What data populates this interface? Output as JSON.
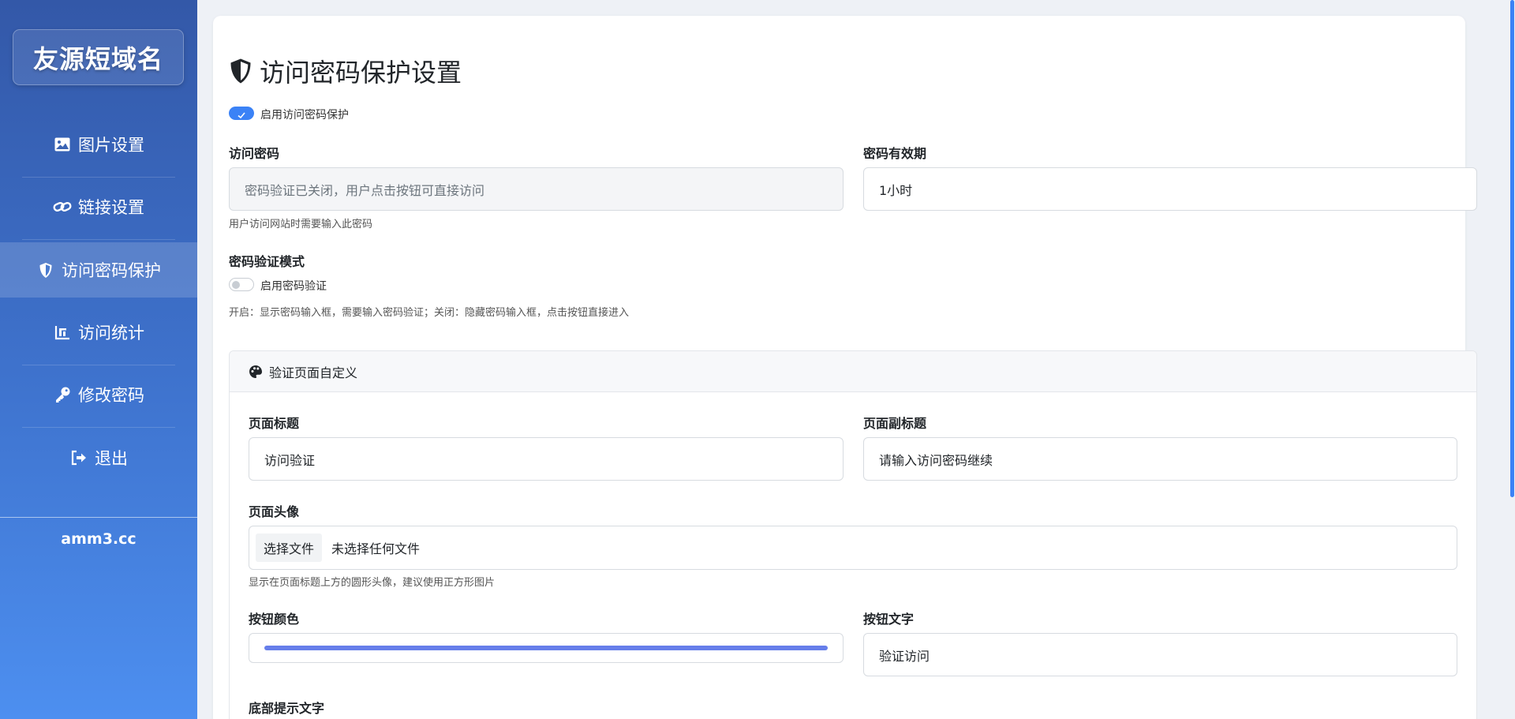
{
  "sidebar": {
    "brand": "友源短域名",
    "items": [
      {
        "label": "图片设置",
        "icon": "image-icon"
      },
      {
        "label": "链接设置",
        "icon": "link-icon"
      },
      {
        "label": "访问密码保护",
        "icon": "shield-icon",
        "active": true
      },
      {
        "label": "访问统计",
        "icon": "chart-icon"
      },
      {
        "label": "修改密码",
        "icon": "key-icon"
      },
      {
        "label": "退出",
        "icon": "logout-icon"
      }
    ],
    "domain": "amm3.cc"
  },
  "page": {
    "title": "访问密码保护设置",
    "enable_protection_label": "启用访问密码保护",
    "enable_protection_on": true,
    "password_label": "访问密码",
    "password_placeholder": "密码验证已关闭，用户点击按钮可直接访问",
    "password_help": "用户访问网站时需要输入此密码",
    "expiry_label": "密码有效期",
    "expiry_value": "1小时",
    "verify_mode_label": "密码验证模式",
    "verify_switch_label": "启用密码验证",
    "verify_switch_on": false,
    "verify_help": "开启：显示密码输入框，需要输入密码验证；关闭：隐藏密码输入框，点击按钮直接进入"
  },
  "custom_panel": {
    "header": "验证页面自定义",
    "page_title_label": "页面标题",
    "page_title_value": "访问验证",
    "page_subtitle_label": "页面副标题",
    "page_subtitle_value": "请输入访问密码继续",
    "avatar_label": "页面头像",
    "file_button": "选择文件",
    "file_status": "未选择任何文件",
    "avatar_help": "显示在页面标题上方的圆形头像，建议使用正方形图片",
    "button_color_label": "按钮颜色",
    "button_color_value": "#667eea",
    "button_text_label": "按钮文字",
    "button_text_value": "验证访问",
    "footer_text_label": "底部提示文字"
  },
  "colors": {
    "accent": "#3b82f6",
    "sidebar_top": "#3358a8",
    "sidebar_bottom": "#4d8ff0"
  }
}
